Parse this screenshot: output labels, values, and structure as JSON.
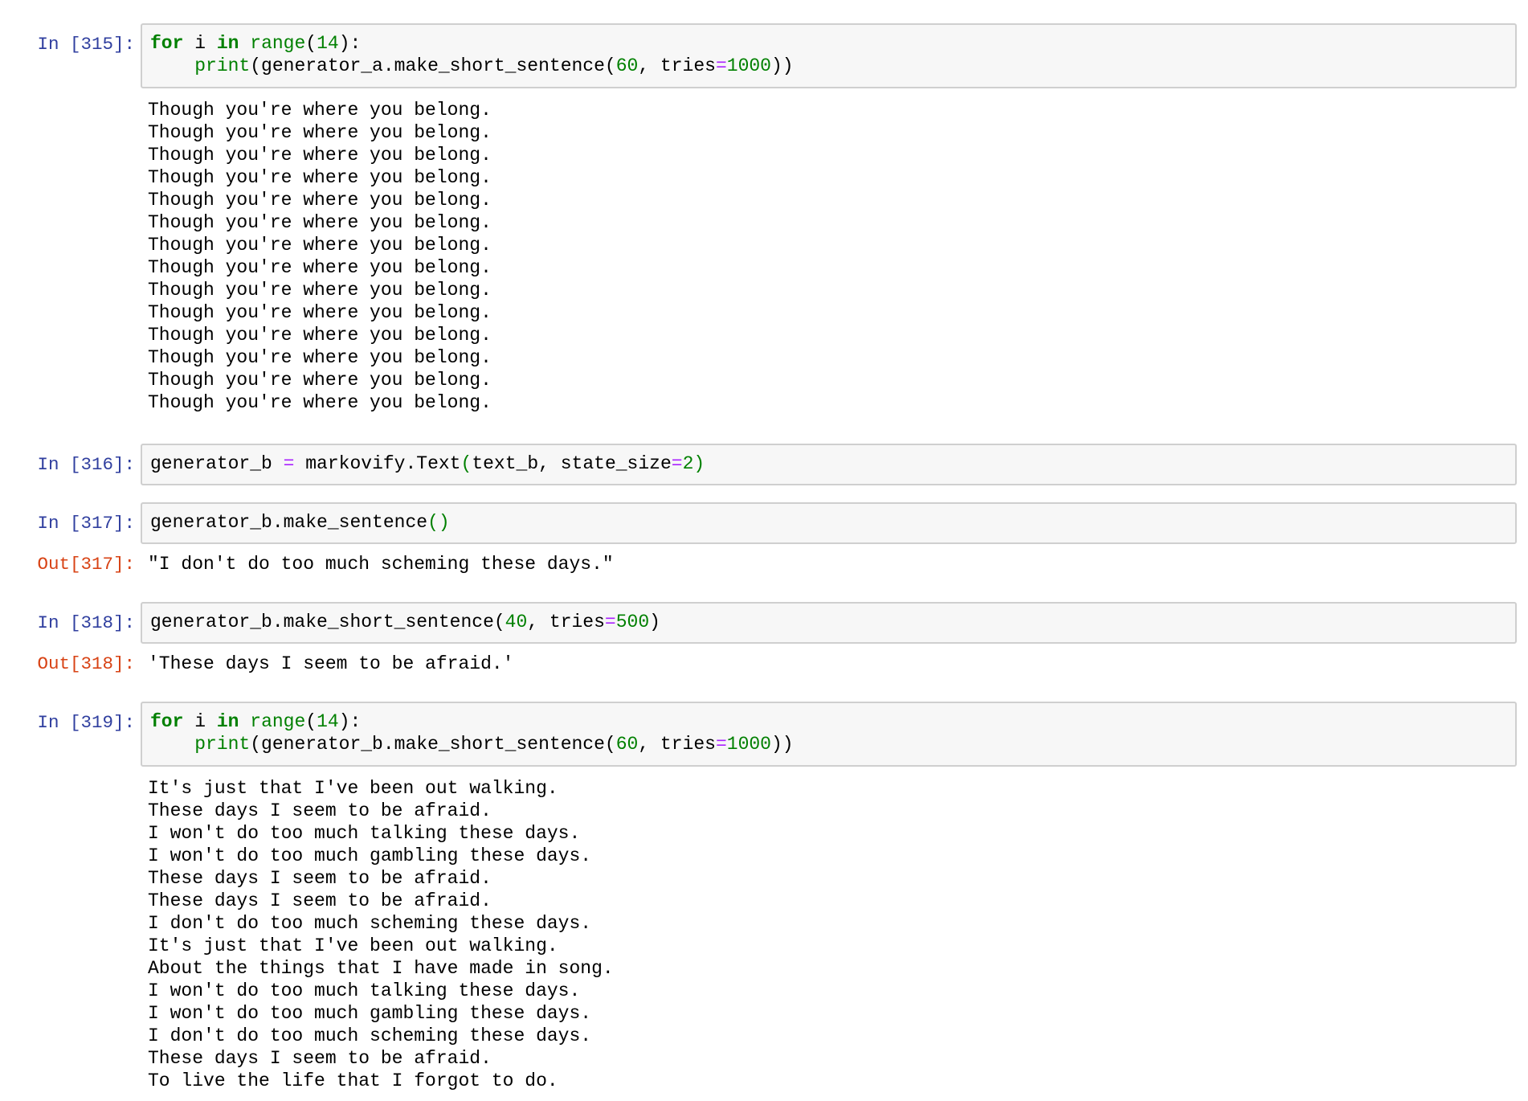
{
  "cells": [
    {
      "in_prompt": "In [315]:",
      "code": [
        [
          [
            "for",
            "kw"
          ],
          [
            " i ",
            ""
          ],
          [
            "in",
            "kw"
          ],
          [
            " ",
            ""
          ],
          [
            "range",
            "bi"
          ],
          [
            "(",
            ""
          ],
          [
            "14",
            "num"
          ],
          [
            "):",
            ""
          ]
        ],
        [
          [
            "    ",
            ""
          ],
          [
            "print",
            "bi"
          ],
          [
            "(generator_a.make_short_sentence(",
            ""
          ],
          [
            "60",
            "num"
          ],
          [
            ", tries",
            ""
          ],
          [
            "=",
            "op"
          ],
          [
            "1000",
            "num"
          ],
          [
            "))",
            ""
          ]
        ]
      ],
      "stdout": [
        "Though you're where you belong.",
        "Though you're where you belong.",
        "Though you're where you belong.",
        "Though you're where you belong.",
        "Though you're where you belong.",
        "Though you're where you belong.",
        "Though you're where you belong.",
        "Though you're where you belong.",
        "Though you're where you belong.",
        "Though you're where you belong.",
        "Though you're where you belong.",
        "Though you're where you belong.",
        "Though you're where you belong.",
        "Though you're where you belong."
      ]
    },
    {
      "in_prompt": "In [316]:",
      "code": [
        [
          [
            "generator_b ",
            ""
          ],
          [
            "=",
            "op"
          ],
          [
            " markovify.Text",
            ""
          ],
          [
            "(",
            "bi"
          ],
          [
            "text_b, state_size",
            ""
          ],
          [
            "=",
            "op"
          ],
          [
            "2",
            "num"
          ],
          [
            ")",
            "bi"
          ]
        ]
      ]
    },
    {
      "in_prompt": "In [317]:",
      "code": [
        [
          [
            "generator_b.make_sentence",
            ""
          ],
          [
            "()",
            "bi"
          ]
        ]
      ],
      "out_prompt": "Out[317]:",
      "result": "\"I don't do too much scheming these days.\""
    },
    {
      "in_prompt": "In [318]:",
      "code": [
        [
          [
            "generator_b.make_short_sentence(",
            ""
          ],
          [
            "40",
            "num"
          ],
          [
            ", tries",
            ""
          ],
          [
            "=",
            "op"
          ],
          [
            "500",
            "num"
          ],
          [
            ")",
            ""
          ]
        ]
      ],
      "out_prompt": "Out[318]:",
      "result": "'These days I seem to be afraid.'"
    },
    {
      "in_prompt": "In [319]:",
      "code": [
        [
          [
            "for",
            "kw"
          ],
          [
            " i ",
            ""
          ],
          [
            "in",
            "kw"
          ],
          [
            " ",
            ""
          ],
          [
            "range",
            "bi"
          ],
          [
            "(",
            ""
          ],
          [
            "14",
            "num"
          ],
          [
            "):",
            ""
          ]
        ],
        [
          [
            "    ",
            ""
          ],
          [
            "print",
            "bi"
          ],
          [
            "(generator_b.make_short_sentence(",
            ""
          ],
          [
            "60",
            "num"
          ],
          [
            ", tries",
            ""
          ],
          [
            "=",
            "op"
          ],
          [
            "1000",
            "num"
          ],
          [
            "))",
            ""
          ]
        ]
      ],
      "stdout": [
        "It's just that I've been out walking.",
        "These days I seem to be afraid.",
        "I won't do too much talking these days.",
        "I won't do too much gambling these days.",
        "These days I seem to be afraid.",
        "These days I seem to be afraid.",
        "I don't do too much scheming these days.",
        "It's just that I've been out walking.",
        "About the things that I have made in song.",
        "I won't do too much talking these days.",
        "I won't do too much gambling these days.",
        "I don't do too much scheming these days.",
        "These days I seem to be afraid.",
        "To live the life that I forgot to do."
      ]
    }
  ]
}
